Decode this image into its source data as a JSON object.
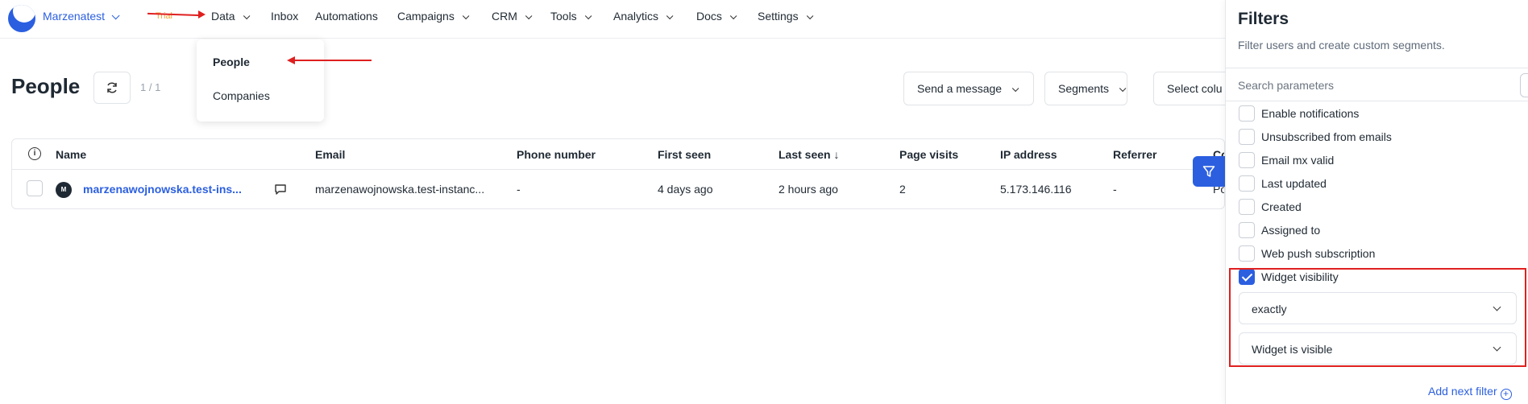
{
  "topbar": {
    "account_name": "Marzenatest",
    "trial_badge": "Trial",
    "nav": [
      {
        "label": "Data",
        "has_menu": true
      },
      {
        "label": "Inbox",
        "has_menu": false
      },
      {
        "label": "Automations",
        "has_menu": false
      },
      {
        "label": "Campaigns",
        "has_menu": true
      },
      {
        "label": "CRM",
        "has_menu": true
      },
      {
        "label": "Tools",
        "has_menu": true
      },
      {
        "label": "Analytics",
        "has_menu": true
      },
      {
        "label": "Docs",
        "has_menu": true
      },
      {
        "label": "Settings",
        "has_menu": true
      }
    ]
  },
  "data_menu": {
    "items": [
      {
        "label": "People",
        "active": true
      },
      {
        "label": "Companies",
        "active": false
      }
    ]
  },
  "page": {
    "title": "People",
    "page_count": "1 / 1",
    "send_message_label": "Send a message",
    "segments_label": "Segments",
    "select_columns_label": "Select colu"
  },
  "table": {
    "columns": [
      "Name",
      "Email",
      "Phone number",
      "First seen",
      "Last seen",
      "Page visits",
      "IP address",
      "Referrer",
      "Co"
    ],
    "sort_column": "Last seen",
    "rows": [
      {
        "avatar_letter": "M",
        "name": "marzenawojnowska.test-ins...",
        "email": "marzenawojnowska.test-instanc...",
        "phone": "-",
        "first_seen": "4 days ago",
        "last_seen": "2 hours ago",
        "page_visits": "2",
        "ip": "5.173.146.116",
        "referrer": "-",
        "co": "Po"
      }
    ]
  },
  "filters": {
    "title": "Filters",
    "subtitle": "Filter users and create custom segments.",
    "search_placeholder": "Search parameters",
    "options": [
      {
        "label": "Enable notifications",
        "checked": false
      },
      {
        "label": "Unsubscribed from emails",
        "checked": false
      },
      {
        "label": "Email mx valid",
        "checked": false
      },
      {
        "label": "Last updated",
        "checked": false
      },
      {
        "label": "Created",
        "checked": false
      },
      {
        "label": "Assigned to",
        "checked": false
      },
      {
        "label": "Web push subscription",
        "checked": false
      },
      {
        "label": "Widget visibility",
        "checked": true
      }
    ],
    "operator_value": "exactly",
    "value_value": "Widget is visible",
    "add_next_label": "Add next filter"
  },
  "colors": {
    "accent": "#2b5fe0",
    "annotation": "#e02020",
    "trial": "#f1a93a"
  }
}
